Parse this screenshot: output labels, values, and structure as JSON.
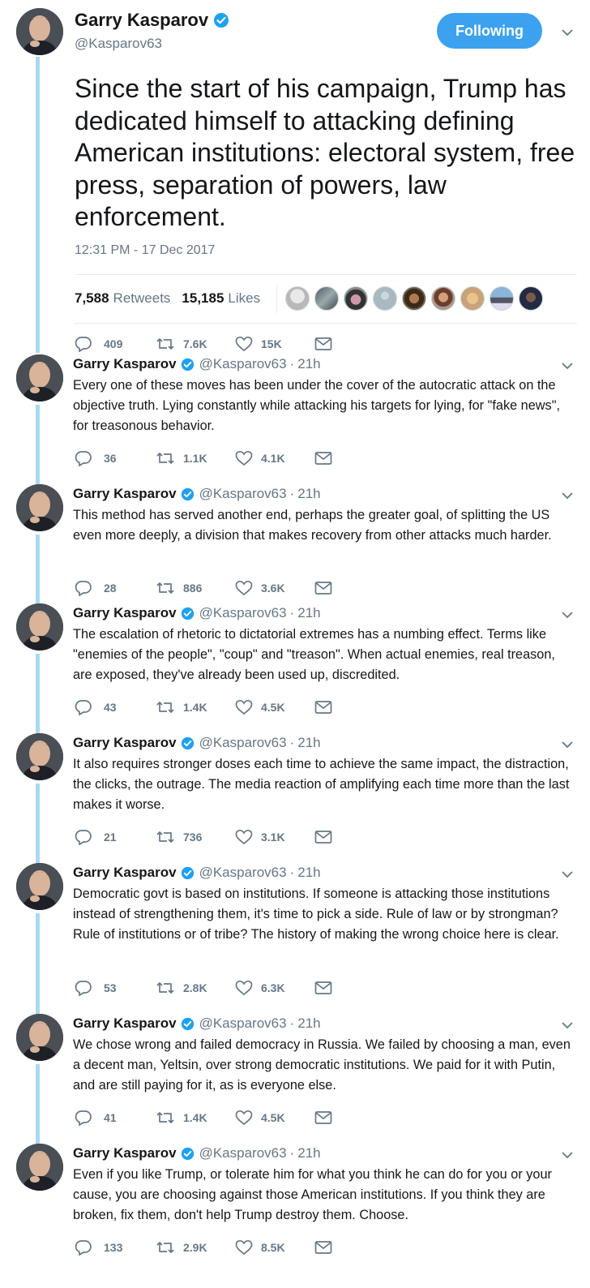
{
  "colors": {
    "accent": "#3ca2ef",
    "thread_line": "#a9d9f3",
    "secondary_text": "#657786",
    "verified": "#1da1f2"
  },
  "main_tweet": {
    "name": "Garry Kasparov",
    "handle": "@Kasparov63",
    "follow_label": "Following",
    "text": "Since the start of his campaign, Trump has dedicated himself to attacking defining American institutions: electoral system, free press, separation of powers, law enforcement.",
    "timestamp": "12:31 PM - 17 Dec 2017",
    "retweets_count": "7,588",
    "retweets_label": "Retweets",
    "likes_count": "15,185",
    "likes_label": "Likes",
    "actions": {
      "replies": "409",
      "retweets": "7.6K",
      "likes": "15K"
    }
  },
  "replies": [
    {
      "name": "Garry Kasparov",
      "handle": "@Kasparov63",
      "dot": "·",
      "time": "21h",
      "text": "Every one of these moves has been under the cover of the autocratic attack on the objective truth. Lying constantly while attacking his targets for lying, for \"fake news\", for treasonous behavior.",
      "replies": "36",
      "retweets": "1.1K",
      "likes": "4.1K"
    },
    {
      "name": "Garry Kasparov",
      "handle": "@Kasparov63",
      "dot": "·",
      "time": "21h",
      "text": "This method has served another end, perhaps the greater goal, of splitting the US even more deeply, a division that makes recovery from other attacks much harder.",
      "replies": "28",
      "retweets": "886",
      "likes": "3.6K"
    },
    {
      "name": "Garry Kasparov",
      "handle": "@Kasparov63",
      "dot": "·",
      "time": "21h",
      "text": "The escalation of rhetoric to dictatorial extremes has a numbing effect. Terms like \"enemies of the people\", \"coup\" and \"treason\". When actual enemies, real treason, are exposed, they've already been used up, discredited.",
      "replies": "43",
      "retweets": "1.4K",
      "likes": "4.5K"
    },
    {
      "name": "Garry Kasparov",
      "handle": "@Kasparov63",
      "dot": "·",
      "time": "21h",
      "text": "It also requires stronger doses each time to achieve the same impact, the distraction, the clicks, the outrage. The media reaction of amplifying each time more than the last makes it worse.",
      "replies": "21",
      "retweets": "736",
      "likes": "3.1K"
    },
    {
      "name": "Garry Kasparov",
      "handle": "@Kasparov63",
      "dot": "·",
      "time": "21h",
      "text": "Democratic govt is based on institutions. If someone is attacking those institutions instead of strengthening them, it's time to pick a side. Rule of law or by strongman? Rule of institutions or of tribe? The history of making the wrong choice here is clear.",
      "replies": "53",
      "retweets": "2.8K",
      "likes": "6.3K"
    },
    {
      "name": "Garry Kasparov",
      "handle": "@Kasparov63",
      "dot": "·",
      "time": "21h",
      "text": "We chose wrong and failed democracy in Russia. We failed by choosing a man, even a decent man, Yeltsin, over strong democratic institutions. We paid for it with Putin, and are still paying for it, as is everyone else.",
      "replies": "41",
      "retweets": "1.4K",
      "likes": "4.5K"
    },
    {
      "name": "Garry Kasparov",
      "handle": "@Kasparov63",
      "dot": "·",
      "time": "21h",
      "text": "Even if you like Trump, or tolerate him for what you think he can do for you or your cause, you are choosing against those American institutions. If you think they are broken, fix them, don't help Trump destroy them. Choose.",
      "replies": "133",
      "retweets": "2.9K",
      "likes": "8.5K"
    }
  ]
}
